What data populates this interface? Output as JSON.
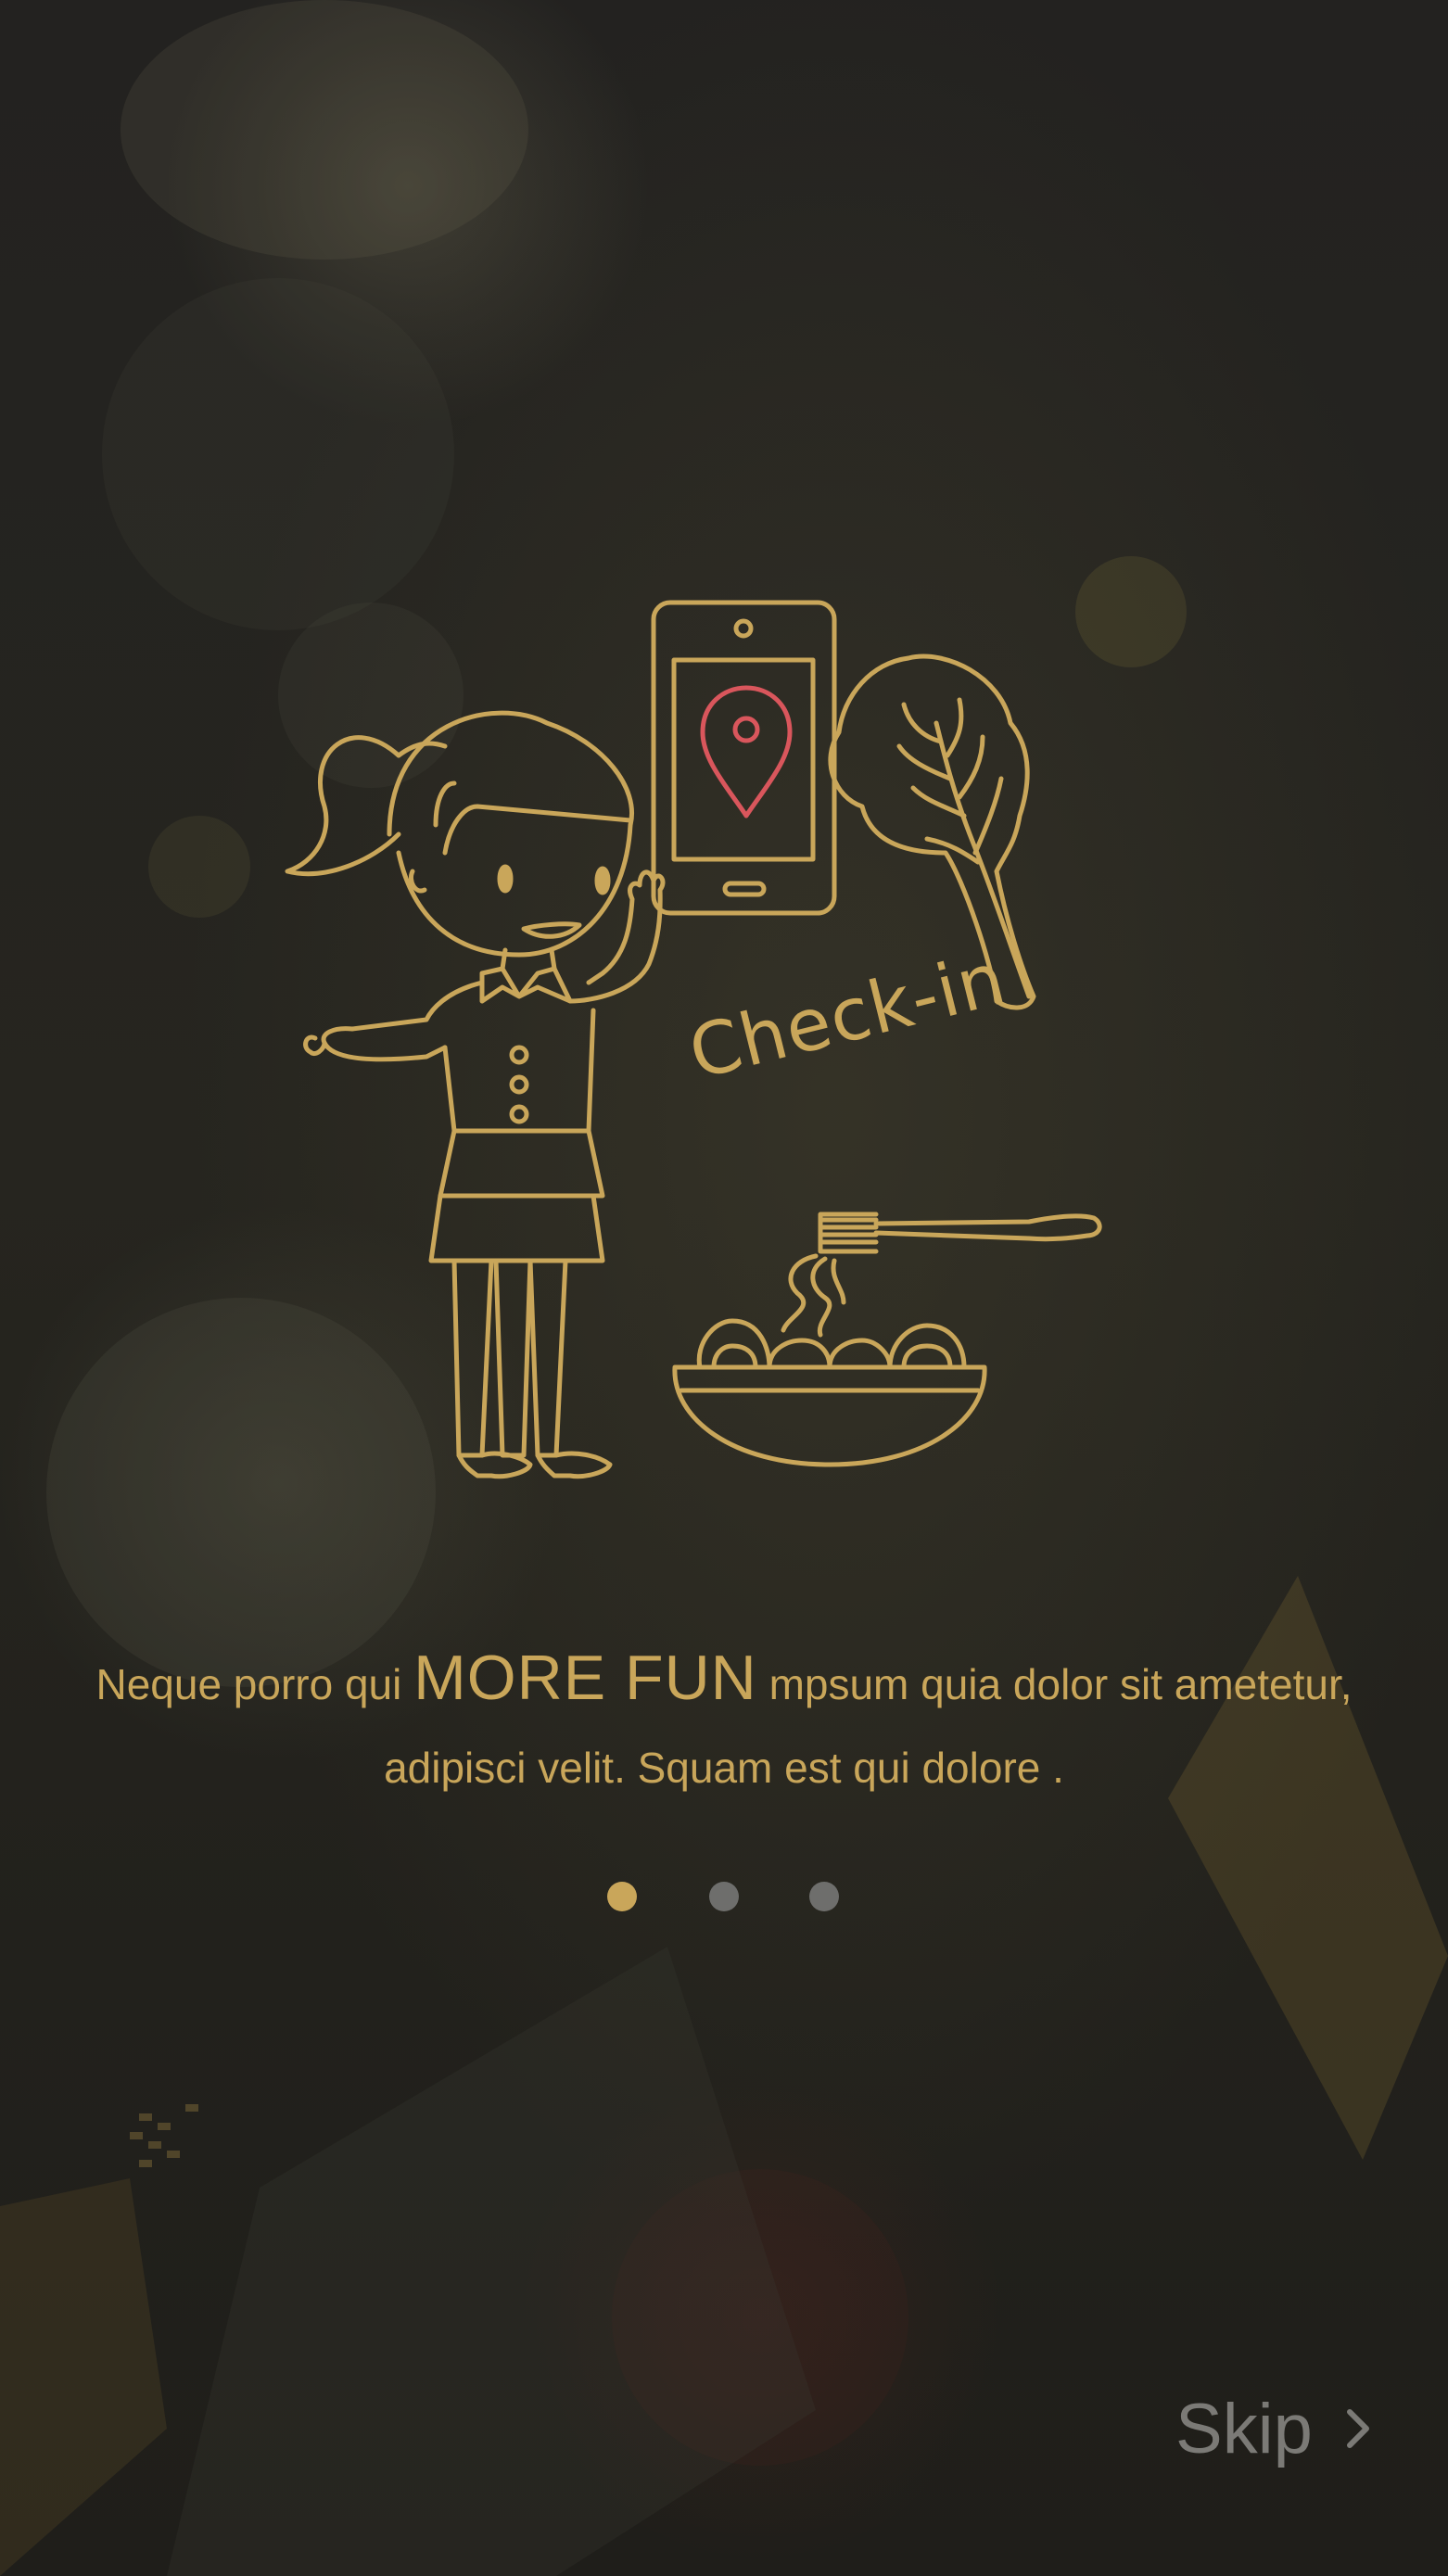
{
  "illustration": {
    "checkin_label": "Check-in"
  },
  "intro": {
    "text_before": "Neque porro qui ",
    "highlight": "MORE FUN",
    "text_after": " mpsum quia dolor sit ametetur, adipisci velit. Squam est qui dolore ."
  },
  "pager": {
    "page_count": 3,
    "active_index": 0
  },
  "skip": {
    "label": "Skip"
  },
  "colors": {
    "background": "#1f1e1b",
    "accent_gold": "#c9a65a",
    "pin_red": "#d9565c",
    "dot_inactive": "#6e6e6c",
    "skip_text": "#7b7a76"
  },
  "icons": {
    "pin": "map-pin-icon",
    "skip_arrow": "chevron-right-icon"
  }
}
